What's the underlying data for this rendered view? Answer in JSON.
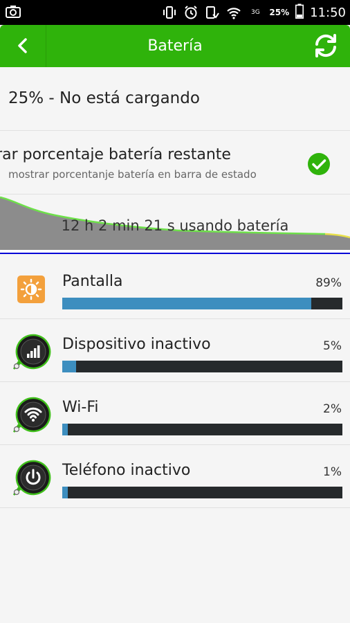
{
  "status_bar": {
    "network_label": "3G",
    "battery_percent": "25%",
    "time": "11:50"
  },
  "app_bar": {
    "title": "Batería",
    "accent_color": "#2fb30b"
  },
  "battery_status": "25% - No está cargando",
  "preference": {
    "title": "strar porcentaje batería restante",
    "subtitle": "mostrar porcentanje batería en barra de estado",
    "checked": true
  },
  "graph": {
    "label": "12 h 2 min 21 s usando batería"
  },
  "usage": [
    {
      "label": "Pantalla",
      "percent_text": "89%",
      "fraction": 0.89,
      "icon": "brightness-icon"
    },
    {
      "label": "Dispositivo inactivo",
      "percent_text": "5%",
      "fraction": 0.05,
      "icon": "signal-bars-icon"
    },
    {
      "label": "Wi-Fi",
      "percent_text": "2%",
      "fraction": 0.02,
      "icon": "wifi-icon"
    },
    {
      "label": "Teléfono inactivo",
      "percent_text": "1%",
      "fraction": 0.01,
      "icon": "power-icon"
    }
  ]
}
